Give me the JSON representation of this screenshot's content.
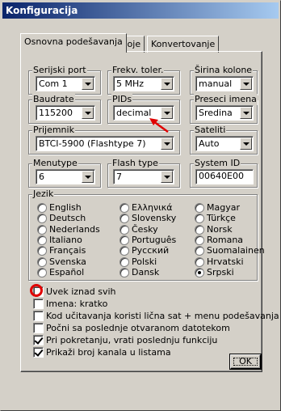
{
  "window": {
    "title": "Konfiguracija"
  },
  "tabs": [
    {
      "label": "Osnovna podešavanja",
      "active": true
    },
    {
      "label": "Boje",
      "active": false
    },
    {
      "label": "Konvertovanje",
      "active": false
    }
  ],
  "groups": {
    "serial_port": {
      "legend": "Serijski port",
      "value": "Com 1"
    },
    "freq_tol": {
      "legend": "Frekv. toler.",
      "value": "5 MHz"
    },
    "col_width": {
      "legend": "Širina kolone",
      "value": "manual"
    },
    "baudrate": {
      "legend": "Baudrate",
      "value": "115200"
    },
    "pids": {
      "legend": "PIDs",
      "value": "decimal"
    },
    "name_cut": {
      "legend": "Preseci imena",
      "value": "Sredina"
    },
    "receiver": {
      "legend": "Prijemnik",
      "value": "BTCI-5900 (Flashtype 7)"
    },
    "satellites": {
      "legend": "Sateliti",
      "value": "Auto"
    },
    "menutype": {
      "legend": "Menutype",
      "value": "6"
    },
    "flash_type": {
      "legend": "Flash type",
      "value": "7"
    },
    "system_id": {
      "legend": "System ID",
      "value": "00640E00"
    }
  },
  "language": {
    "legend": "Jezik",
    "selected": "Srpski",
    "columns": [
      [
        "English",
        "Deutsch",
        "Nederlands",
        "Italiano",
        "Français",
        "Svenska",
        "Español"
      ],
      [
        "Ελληνικά",
        "Slovensky",
        "Česky",
        "Português",
        "Русский",
        "Polski",
        "Dansk"
      ],
      [
        "Magyar",
        "Türkçe",
        "Norsk",
        "Romana",
        "Suomalainen",
        "Hrvatski",
        "Srpski"
      ]
    ]
  },
  "options": [
    {
      "label": "Uvek iznad svih",
      "checked": false
    },
    {
      "label": "Imena: kratko",
      "checked": false
    },
    {
      "label": "Kod učitavanja koristi lična sat + menu podešavanja",
      "checked": false
    },
    {
      "label": "Počni sa poslednje otvaranom datotekom",
      "checked": false
    },
    {
      "label": "Pri pokretanju, vrati poslednju funkciju",
      "checked": true
    },
    {
      "label": "Prikaži broj kanala u listama",
      "checked": true
    }
  ],
  "buttons": {
    "ok": "OK"
  },
  "annotations": {
    "arrow_color": "#e00000",
    "circle_color": "#e00000"
  }
}
